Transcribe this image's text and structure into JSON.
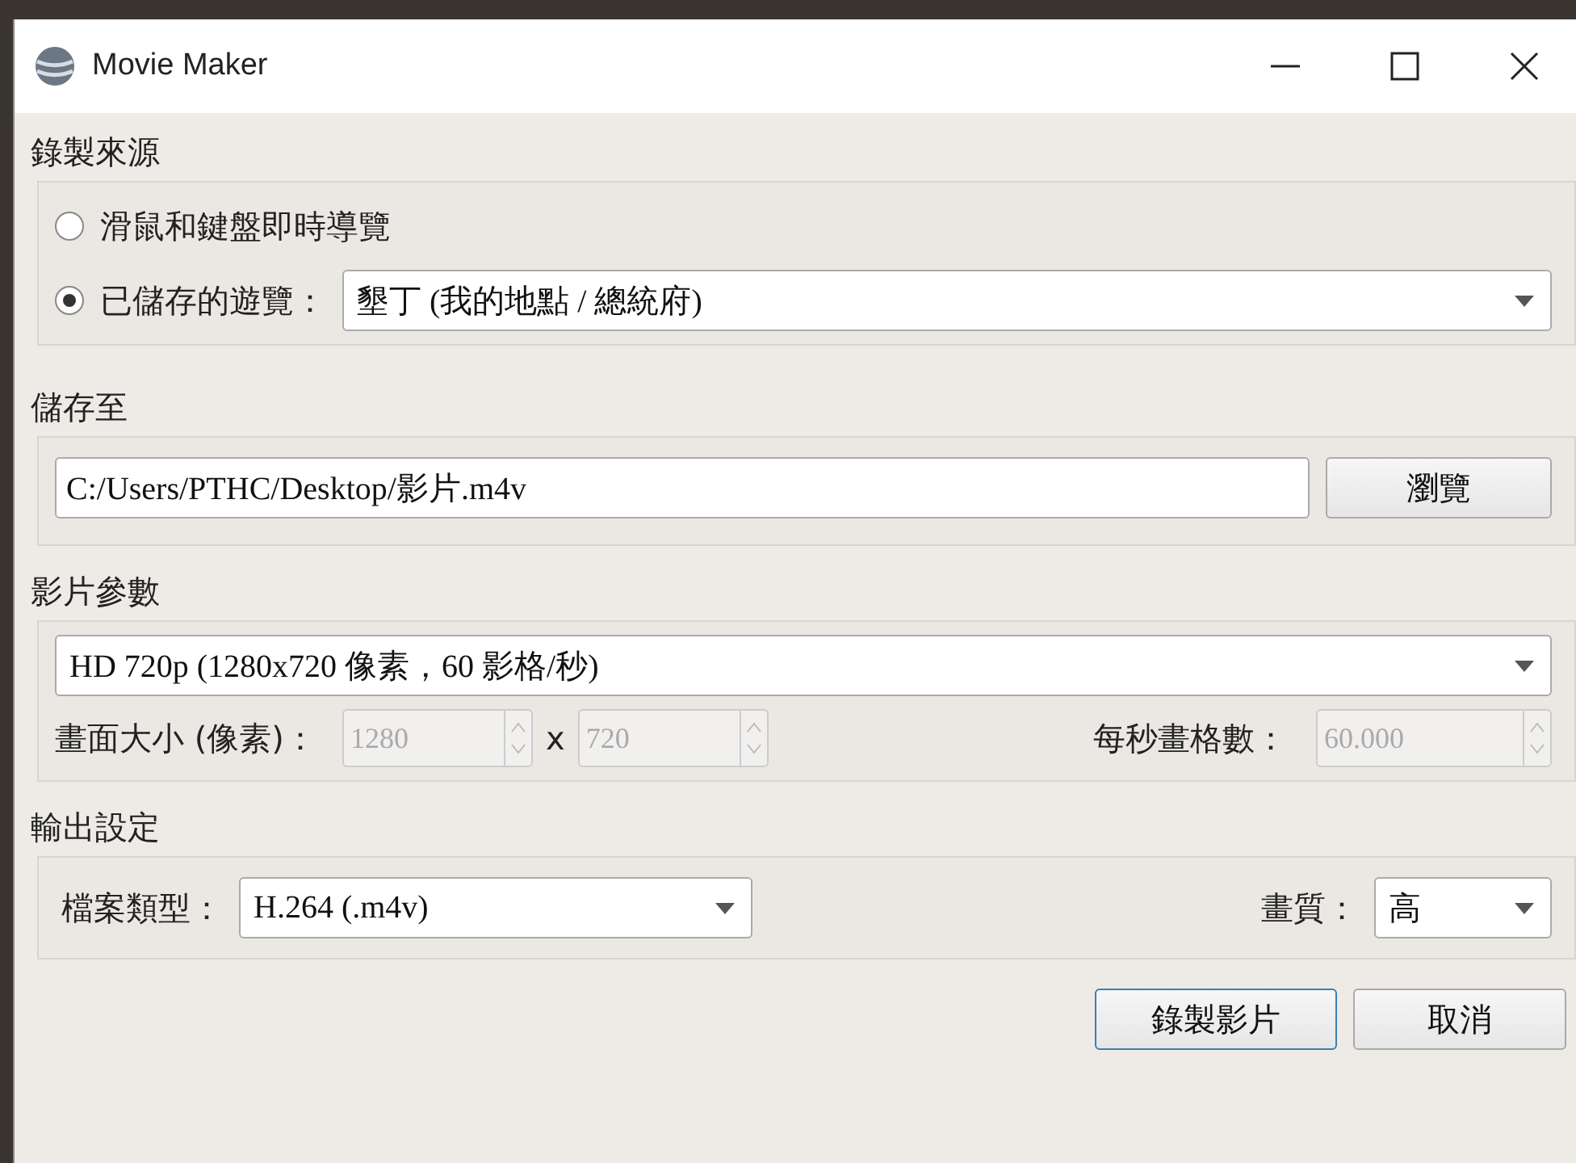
{
  "window": {
    "title": "Movie Maker"
  },
  "source": {
    "label": "錄製來源",
    "options": [
      {
        "label": "滑鼠和鍵盤即時導覽",
        "selected": false
      },
      {
        "label": "已儲存的遊覽：",
        "selected": true
      }
    ],
    "tour": {
      "value": "墾丁 (我的地點 / 總統府)"
    }
  },
  "save": {
    "label": "儲存至",
    "path": "C:/Users/PTHC/Desktop/影片.m4v",
    "browse": "瀏覽"
  },
  "video": {
    "label": "影片參數",
    "preset": "HD 720p (1280x720 像素，60 影格/秒)",
    "size_label": "畫面大小 (像素)：",
    "width": {
      "value": "1280",
      "disabled": true
    },
    "times": "x",
    "height": {
      "value": "720",
      "disabled": true
    },
    "fps_label": "每秒畫格數：",
    "fps": {
      "value": "60.000",
      "disabled": true
    }
  },
  "output": {
    "label": "輸出設定",
    "type_label": "檔案類型：",
    "type": "H.264 (.m4v)",
    "quality_label": "畫質：",
    "quality": "高"
  },
  "buttons": [
    {
      "label": "錄製影片",
      "default": true
    },
    {
      "label": "取消",
      "default": false
    }
  ]
}
